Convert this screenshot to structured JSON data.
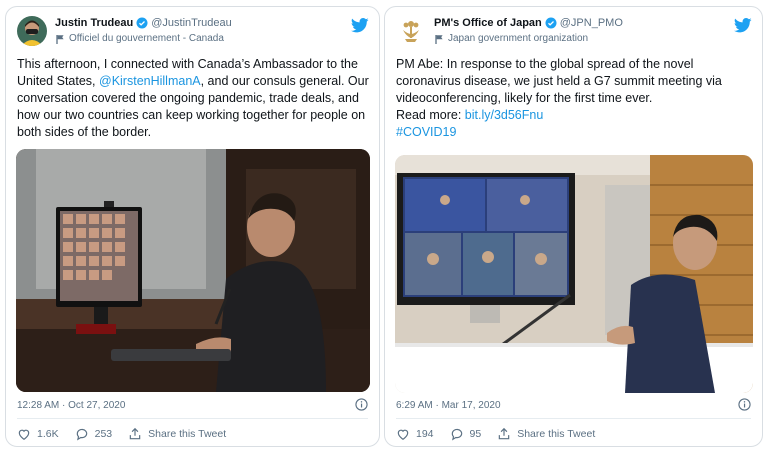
{
  "colors": {
    "link": "#1b95e0",
    "brand": "#1da1f2",
    "muted": "#5b7083",
    "text": "#0f1419"
  },
  "tweets": [
    {
      "name": "Justin Trudeau",
      "handle": "@JustinTrudeau",
      "account_label": "Officiel du gouvernement - Canada",
      "text_segments": {
        "s1": "This afternoon, I connected with Canada’s Ambassador to the United States, ",
        "mention": "@KirstenHillmanA",
        "s2": ", and our consuls general. Our conversation covered the ongoing pandemic, trade deals, and how our two countries can keep working together for people on both sides of the border."
      },
      "timestamp": "12:28 AM · Oct 27, 2020",
      "likes": "1.6K",
      "replies": "253",
      "share": "Share this Tweet",
      "icons": [
        "avatar",
        "verified-icon",
        "government-flag-icon",
        "twitter-bird-icon",
        "info-icon",
        "heart-icon",
        "reply-icon",
        "share-icon"
      ]
    },
    {
      "name": "PM's Office of Japan",
      "handle": "@JPN_PMO",
      "account_label": "Japan government organization",
      "text_segments": {
        "s1": "PM Abe: In response to the global spread of the novel coronavirus disease, we just held a G7 summit meeting via videoconferencing, likely for the first time ever.",
        "read_more": "Read more: ",
        "link": "bit.ly/3d56Fnu",
        "hashtag": "#COVID19"
      },
      "timestamp": "6:29 AM · Mar 17, 2020",
      "likes": "194",
      "replies": "95",
      "share": "Share this Tweet",
      "icons": [
        "emblem",
        "verified-icon",
        "government-flag-icon",
        "twitter-bird-icon",
        "info-icon",
        "heart-icon",
        "reply-icon",
        "share-icon"
      ]
    }
  ]
}
